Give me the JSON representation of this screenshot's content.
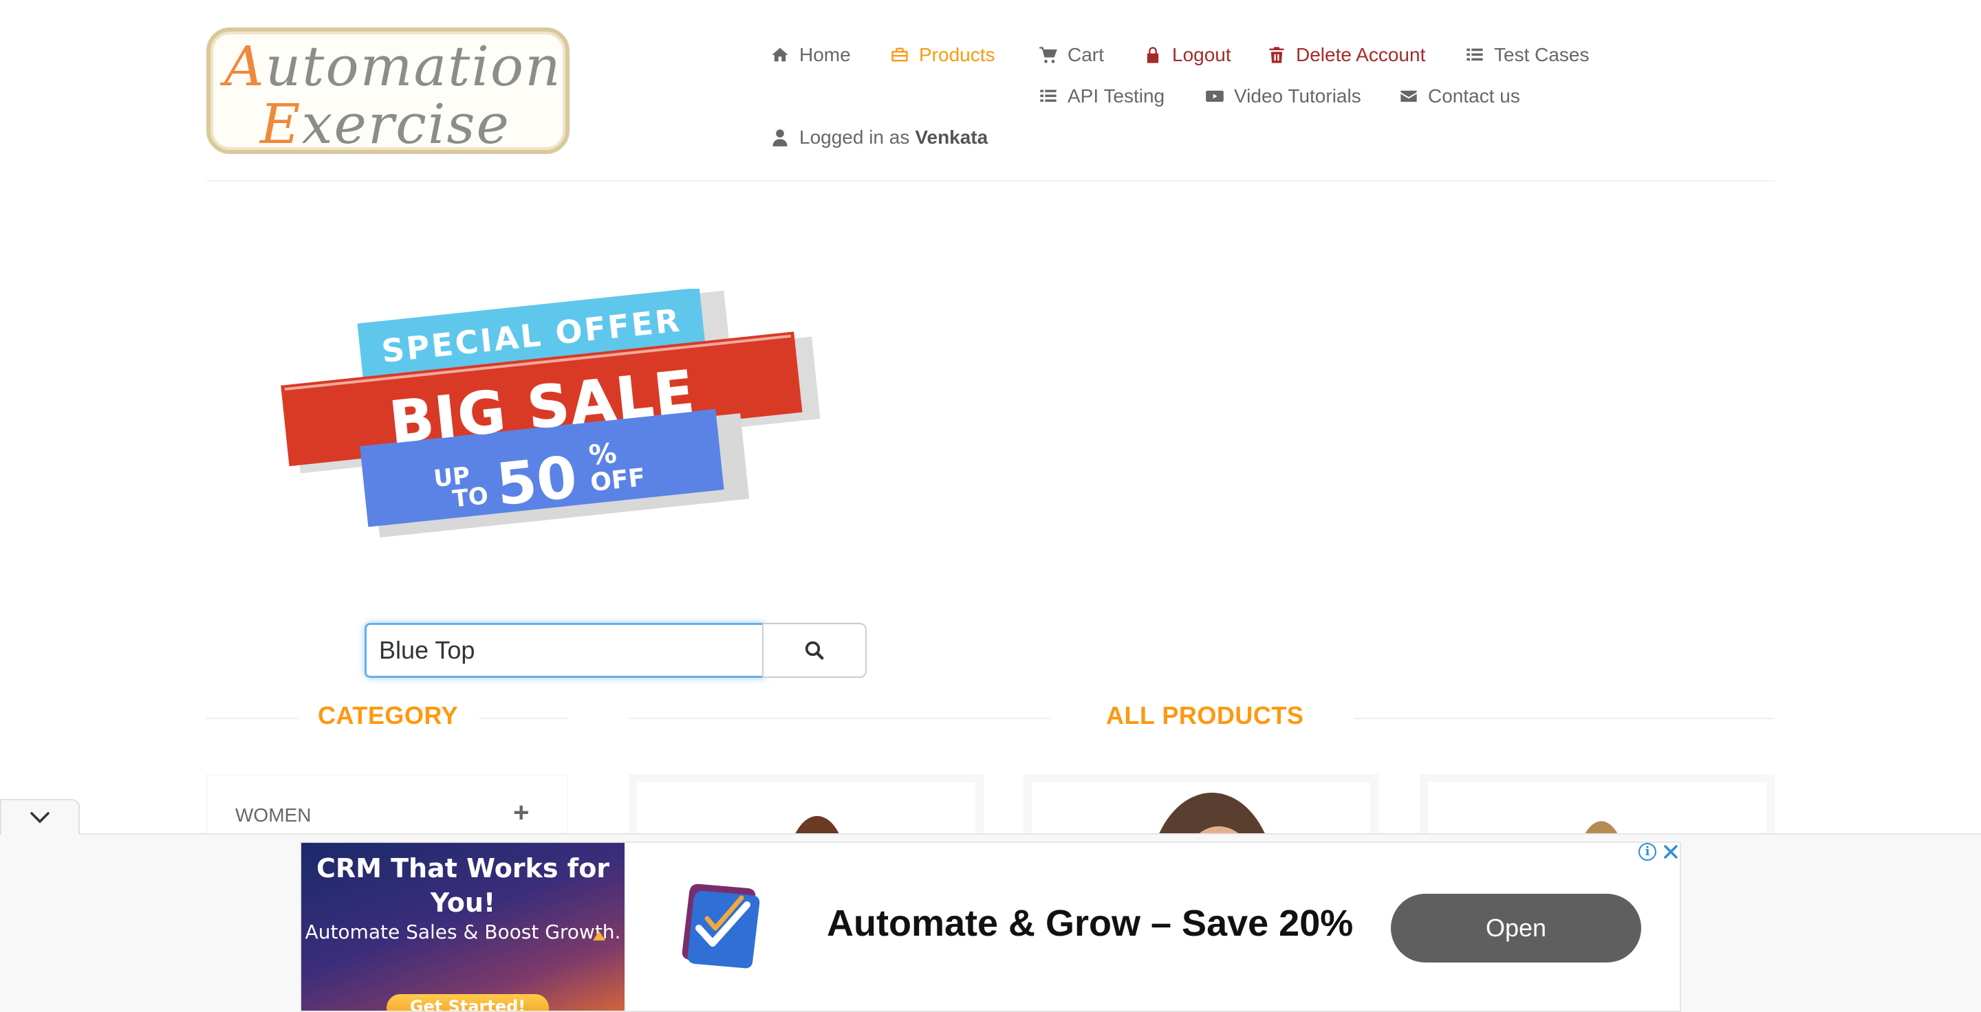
{
  "brand": {
    "line1_cap": "A",
    "line1_rest": "utomation",
    "line2_cap": "E",
    "line2_rest": "xercise"
  },
  "nav": {
    "home": "Home",
    "products": "Products",
    "cart": "Cart",
    "logout": "Logout",
    "delete_account": "Delete Account",
    "test_cases": "Test Cases",
    "api_testing": "API Testing",
    "video_tutorials": "Video Tutorials",
    "contact_us": "Contact us",
    "logged_in_prefix": "Logged in as",
    "username": "Venkata"
  },
  "banner": {
    "line1": "SPECIAL OFFER",
    "line2": "BIG SALE",
    "up": "UP",
    "to": "TO",
    "percent": "50",
    "percent_sign": "%",
    "off": "OFF"
  },
  "search": {
    "value": "Blue Top"
  },
  "sections": {
    "category_title": "CATEGORY",
    "products_title": "ALL PRODUCTS"
  },
  "category": {
    "items": [
      {
        "label": "WOMEN",
        "toggle": "+"
      }
    ]
  },
  "ad": {
    "image_headline": "CRM That Works for You!",
    "image_sub": "Automate Sales & Boost Growth.",
    "image_cta": "Get Started!",
    "headline": "Automate & Grow – Save 20%",
    "cta": "Open",
    "info": "i"
  },
  "colors": {
    "accent": "#fe980f",
    "danger": "#a52a2a",
    "text": "#696763",
    "ad_button": "#5f5f5f",
    "focus_border": "#66afe9"
  },
  "icons": {
    "home": "home-icon",
    "products": "briefcase-icon",
    "cart": "cart-icon",
    "logout": "lock-icon",
    "delete": "trash-icon",
    "test_cases": "list-icon",
    "api": "list-icon",
    "video": "youtube-play-icon",
    "contact": "envelope-icon",
    "user": "user-icon",
    "search": "search-icon"
  }
}
